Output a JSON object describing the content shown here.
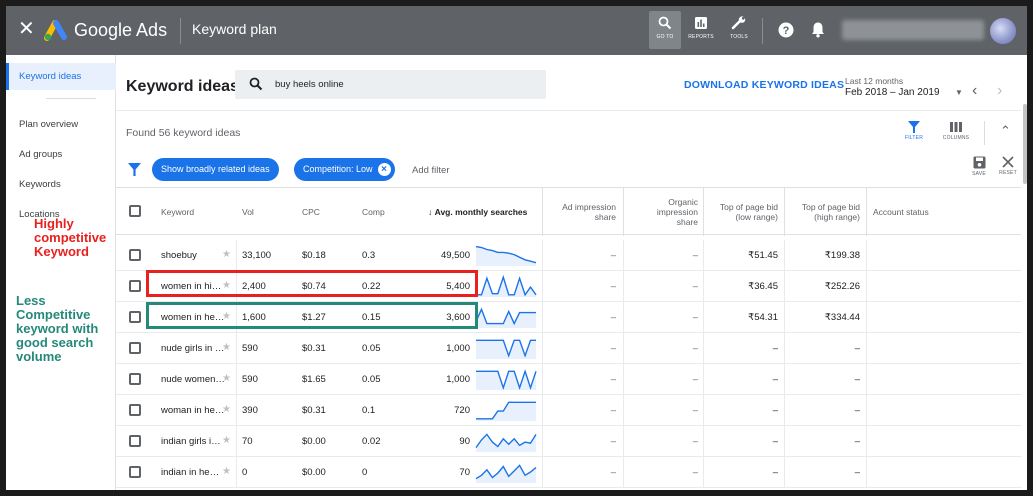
{
  "topbar": {
    "app_name": "Google Ads",
    "page": "Keyword plan",
    "goto": "GO TO",
    "reports": "REPORTS",
    "tools": "TOOLS"
  },
  "sidebar": {
    "items": [
      "Keyword ideas",
      "Plan overview",
      "Ad groups",
      "Keywords",
      "Locations"
    ]
  },
  "annotations": {
    "red": "Highly competitive Keyword",
    "green": "Less Competitive keyword with good search volume"
  },
  "header": {
    "title": "Keyword ideas",
    "search_value": "buy heels online",
    "download": "DOWNLOAD KEYWORD IDEAS",
    "range_label": "Last 12 months",
    "range_value": "Feb 2018 – Jan 2019"
  },
  "summary": {
    "found": "Found 56 keyword ideas",
    "filter_label": "FILTER",
    "columns_label": "COLUMNS",
    "save_label": "SAVE",
    "reset_label": "RESET"
  },
  "filters": {
    "chip1": "Show broadly related ideas",
    "chip2": "Competition: Low",
    "add": "Add filter"
  },
  "columns": {
    "keyword": "Keyword",
    "vol": "Vol",
    "cpc": "CPC",
    "comp": "Comp",
    "avg": "Avg. monthly searches",
    "impression": "Ad impression share",
    "organic": "Organic impression share",
    "bid_low": "Top of page bid (low range)",
    "bid_high": "Top of page bid (high range)",
    "status": "Account status"
  },
  "rows": [
    {
      "keyword": "shoebuy",
      "vol": "33,100",
      "cpc": "$0.18",
      "comp": "0.3",
      "avg": "49,500",
      "imp": "–",
      "org": "–",
      "low": "₹51.45",
      "high": "₹199.38",
      "trend": [
        0.88,
        0.84,
        0.75,
        0.7,
        0.62,
        0.62,
        0.58,
        0.52,
        0.4,
        0.28,
        0.22,
        0.15
      ]
    },
    {
      "keyword": "women in hi…",
      "vol": "2,400",
      "cpc": "$0.74",
      "comp": "0.22",
      "avg": "5,400",
      "imp": "–",
      "org": "–",
      "low": "₹36.45",
      "high": "₹252.26",
      "trend": [
        0.1,
        0.1,
        0.85,
        0.15,
        0.15,
        0.9,
        0.1,
        0.1,
        0.85,
        0.1,
        0.45,
        0.1
      ]
    },
    {
      "keyword": "women in he…",
      "vol": "1,600",
      "cpc": "$1.27",
      "comp": "0.15",
      "avg": "3,600",
      "imp": "–",
      "org": "–",
      "low": "₹54.31",
      "high": "₹334.44",
      "trend": [
        0.3,
        0.85,
        0.2,
        0.2,
        0.2,
        0.2,
        0.75,
        0.2,
        0.7,
        0.7,
        0.7,
        0.7
      ]
    },
    {
      "keyword": "nude girls in …",
      "vol": "590",
      "cpc": "$0.31",
      "comp": "0.05",
      "avg": "1,000",
      "imp": "–",
      "org": "–",
      "low": "–",
      "high": "–",
      "trend": [
        0.85,
        0.85,
        0.85,
        0.85,
        0.85,
        0.85,
        0.15,
        0.85,
        0.85,
        0.15,
        0.85,
        0.85
      ]
    },
    {
      "keyword": "nude women…",
      "vol": "590",
      "cpc": "$1.65",
      "comp": "0.05",
      "avg": "1,000",
      "imp": "–",
      "org": "–",
      "low": "–",
      "high": "–",
      "trend": [
        0.85,
        0.85,
        0.85,
        0.85,
        0.85,
        0.1,
        0.85,
        0.85,
        0.1,
        0.85,
        0.1,
        0.85
      ]
    },
    {
      "keyword": "woman in he…",
      "vol": "390",
      "cpc": "$0.31",
      "comp": "0.1",
      "avg": "720",
      "imp": "–",
      "org": "–",
      "low": "–",
      "high": "–",
      "trend": [
        0.1,
        0.1,
        0.1,
        0.1,
        0.45,
        0.45,
        0.85,
        0.85,
        0.85,
        0.85,
        0.85,
        0.85
      ]
    },
    {
      "keyword": "indian girls i…",
      "vol": "70",
      "cpc": "$0.00",
      "comp": "0.02",
      "avg": "90",
      "imp": "–",
      "org": "–",
      "low": "–",
      "high": "–",
      "trend": [
        0.2,
        0.55,
        0.8,
        0.45,
        0.25,
        0.6,
        0.35,
        0.6,
        0.3,
        0.45,
        0.4,
        0.8
      ]
    },
    {
      "keyword": "indian in he…",
      "vol": "0",
      "cpc": "$0.00",
      "comp": "0",
      "avg": "70",
      "imp": "–",
      "org": "–",
      "low": "–",
      "high": "–",
      "trend": [
        0.2,
        0.35,
        0.6,
        0.25,
        0.45,
        0.75,
        0.3,
        0.55,
        0.8,
        0.35,
        0.5,
        0.7
      ]
    }
  ],
  "colors": {
    "topbar": "#5f6368",
    "accent": "#1a73e8",
    "annotation_red": "#e8211f",
    "annotation_green": "#25897a"
  }
}
